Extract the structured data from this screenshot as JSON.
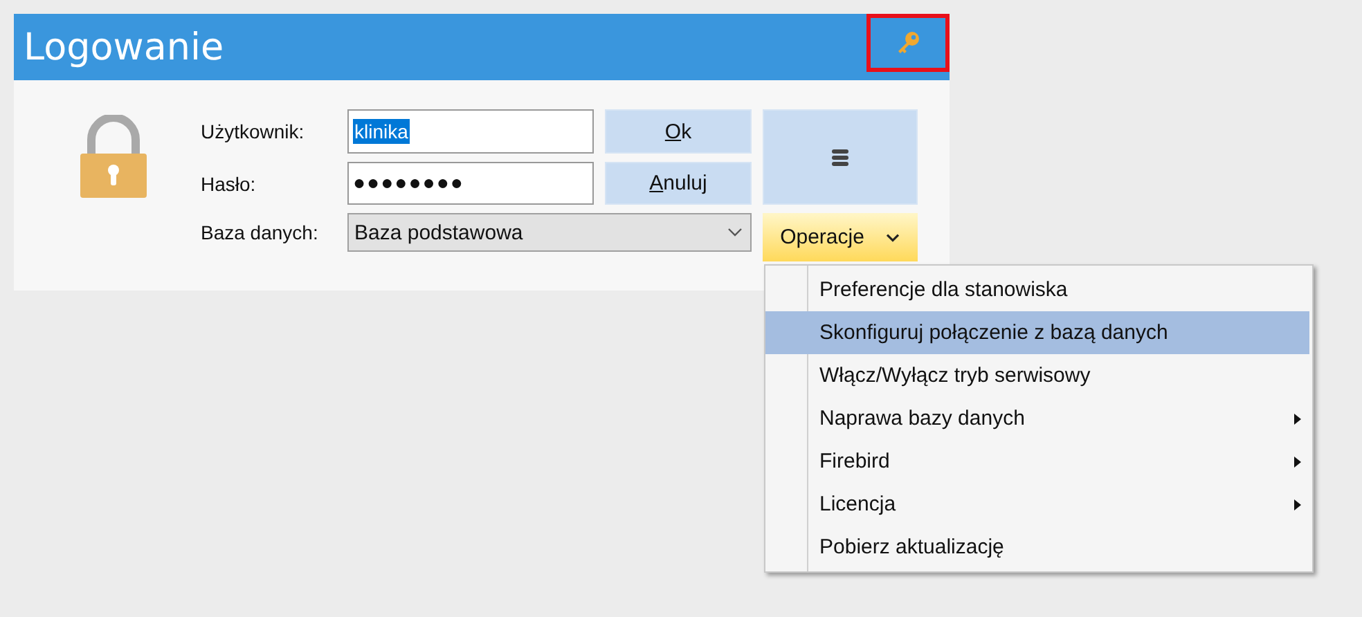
{
  "window": {
    "title": "Logowanie"
  },
  "form": {
    "user_label": "Użytkownik:",
    "user_value": "klinika",
    "user_value_selected": true,
    "password_label": "Hasło:",
    "password_value": "●●●●●●●●",
    "database_label": "Baza danych:",
    "database_value": "Baza podstawowa"
  },
  "buttons": [
    {
      "label": "Ok",
      "underline_first": true
    },
    {
      "label": "Anuluj",
      "underline_first": true
    }
  ],
  "operations_button": {
    "label": "Operacje",
    "expanded": true
  },
  "menu": [
    {
      "label": "Preferencje dla stanowiska",
      "selected": false,
      "submenu": false
    },
    {
      "label": "Skonfiguruj połączenie z bazą danych",
      "selected": true,
      "submenu": false
    },
    {
      "label": "Włącz/Wyłącz tryb serwisowy",
      "selected": false,
      "submenu": false
    },
    {
      "label": "Naprawa bazy danych",
      "selected": false,
      "submenu": true
    },
    {
      "label": "Firebird",
      "selected": false,
      "submenu": true
    },
    {
      "label": "Licencja",
      "selected": false,
      "submenu": true
    },
    {
      "label": "Pobierz aktualizację",
      "selected": false,
      "submenu": false
    }
  ]
}
